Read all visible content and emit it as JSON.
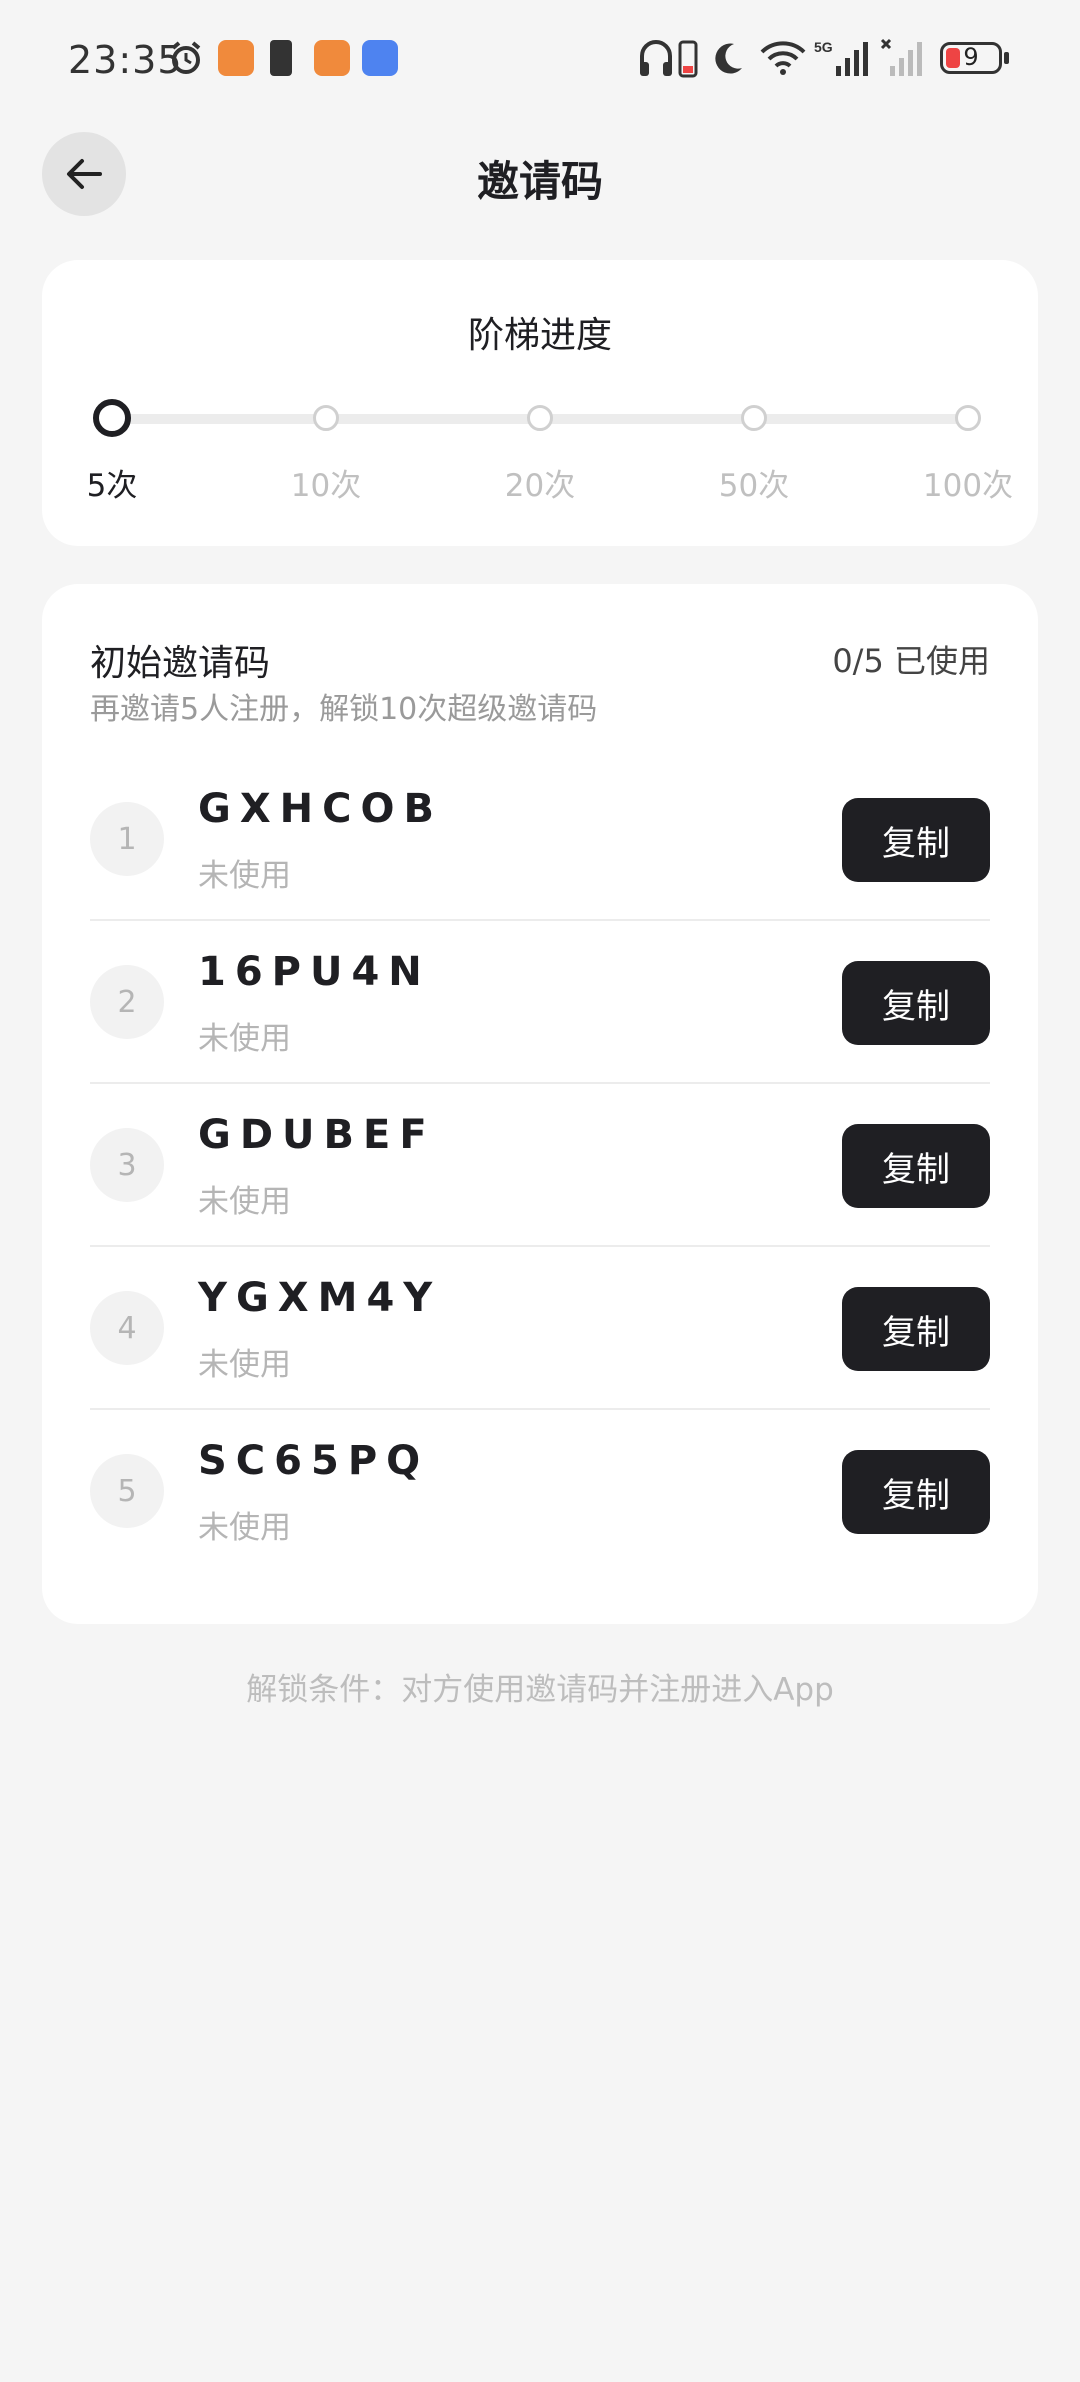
{
  "status_bar": {
    "time": "23:35",
    "battery_level": "9",
    "icons": [
      "alarm-icon",
      "app-notification-icon",
      "battery-warning-icon",
      "app-notification-icon",
      "message-icon",
      "headphones-icon",
      "phone-battery-icon",
      "do-not-disturb-icon",
      "wifi-icon",
      "5g-signal-icon",
      "no-signal-icon",
      "battery-icon"
    ]
  },
  "header": {
    "title": "邀请码",
    "back_icon": "arrow-left-icon"
  },
  "progress": {
    "title": "阶梯进度",
    "current_step_index": 0,
    "steps": [
      {
        "label": "5次"
      },
      {
        "label": "10次"
      },
      {
        "label": "20次"
      },
      {
        "label": "50次"
      },
      {
        "label": "100次"
      }
    ]
  },
  "codes": {
    "title": "初始邀请码",
    "usage": "0/5 已使用",
    "subtitle": "再邀请5人注册，解锁10次超级邀请码",
    "copy_label": "复制",
    "items": [
      {
        "index": "1",
        "code": "GXHCOB",
        "status": "未使用"
      },
      {
        "index": "2",
        "code": "16PU4N",
        "status": "未使用"
      },
      {
        "index": "3",
        "code": "GDUBEF",
        "status": "未使用"
      },
      {
        "index": "4",
        "code": "YGXM4Y",
        "status": "未使用"
      },
      {
        "index": "5",
        "code": "SC65PQ",
        "status": "未使用"
      }
    ]
  },
  "footer": {
    "note": "解锁条件：对方使用邀请码并注册进入App"
  }
}
